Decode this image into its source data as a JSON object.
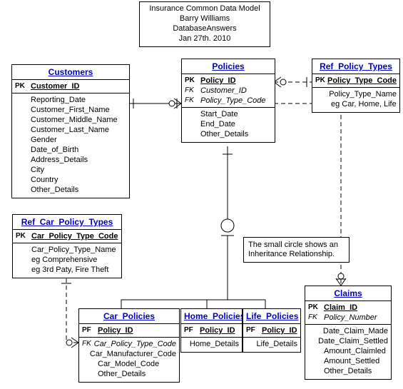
{
  "title": {
    "line1": "Insurance Common Data Model",
    "line2": "Barry Williams",
    "line3": "DatabaseAnswers",
    "line4": "Jan 27th. 2010"
  },
  "note": {
    "line1": "The small circle shows an",
    "line2": "Inheritance Relationship."
  },
  "entities": {
    "customers": {
      "title": "Customers",
      "pk_key": "PK",
      "pk_name": "Customer_ID",
      "attrs": [
        "Reporting_Date",
        "Customer_First_Name",
        "Customer_Middle_Name",
        "Customer_Last_Name",
        "Gender",
        "Date_of_Birth",
        "Address_Details",
        "City",
        "Country",
        "Other_Details"
      ]
    },
    "policies": {
      "title": "Policies",
      "pk_key": "PK",
      "pk_name": "Policy_ID",
      "fk1_key": "FK",
      "fk1_name": "Customer_ID",
      "fk2_key": "FK",
      "fk2_name": "Policy_Type_Code",
      "attrs": [
        "Start_Date",
        "End_Date",
        "Other_Details"
      ]
    },
    "ref_policy_types": {
      "title": "Ref_Policy_Types",
      "pk_key": "PK",
      "pk_name": "Policy_Type_Code",
      "attrs": [
        "Policy_Type_Name",
        "eg Car, Home, Life"
      ]
    },
    "ref_car_policy_types": {
      "title": "Ref_Car_Policy_Types",
      "pk_key": "PK",
      "pk_name": "Car_Policy_Type_Code",
      "attrs": [
        "Car_Policy_Type_Name",
        "eg Comprehensive",
        "eg 3rd Paty, Fire Theft"
      ]
    },
    "car_policies": {
      "title": "Car_Policies",
      "pf_key": "PF",
      "pf_name": "Policy_ID",
      "fk_key": "FK",
      "fk_name": "Car_Policy_Type_Code",
      "attrs": [
        "Car_Manufacturer_Code",
        "Car_Model_Code",
        "Other_Details"
      ]
    },
    "home_policies": {
      "title": "Home_Policies",
      "pf_key": "PF",
      "pf_name": "Policy_ID",
      "attrs": [
        "Home_Details"
      ]
    },
    "life_policies": {
      "title": "Life_Policies",
      "pf_key": "PF",
      "pf_name": "Policy_ID",
      "attrs": [
        "Life_Details"
      ]
    },
    "claims": {
      "title": "Claims",
      "pk_key": "PK",
      "pk_name": "Claim_ID",
      "fk_key": "FK",
      "fk_name": "Policy_Number",
      "attrs": [
        "Date_Claim_Made",
        "Date_Claim_Settled",
        "Amount_Claimled",
        "Amount_Settled",
        "Other_Details"
      ]
    }
  }
}
